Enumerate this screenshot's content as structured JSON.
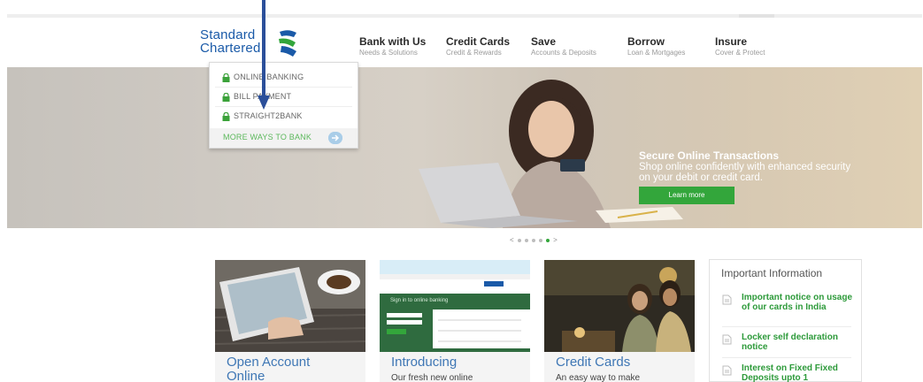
{
  "brand": {
    "name_line1": "Standard",
    "name_line2": "Chartered",
    "colors": {
      "blue": "#1a5aa8",
      "green": "#33a63b"
    }
  },
  "nav": [
    {
      "title": "Bank with Us",
      "subtitle": "Needs & Solutions"
    },
    {
      "title": "Credit Cards",
      "subtitle": "Credit & Rewards"
    },
    {
      "title": "Save",
      "subtitle": "Accounts & Deposits"
    },
    {
      "title": "Borrow",
      "subtitle": "Loan & Mortgages"
    },
    {
      "title": "Insure",
      "subtitle": "Cover & Protect"
    }
  ],
  "login_menu": {
    "items": [
      {
        "label": "ONLINE BANKING",
        "icon": "lock-icon"
      },
      {
        "label": "BILL PAYMENT",
        "icon": "lock-icon"
      },
      {
        "label": "STRAIGHT2BANK",
        "icon": "lock-icon"
      }
    ],
    "more_label": "MORE WAYS TO BANK",
    "more_icon": "arrow-right-icon"
  },
  "hero": {
    "title": "Secure Online Transactions",
    "text_line1": "Shop online confidently with enhanced security",
    "text_line2": "on your debit or credit card.",
    "button": "Learn more"
  },
  "carousel": {
    "prev": "<",
    "next": ">",
    "count": 5,
    "active": 4
  },
  "cards": [
    {
      "title": "Open Account",
      "title2": "Online",
      "desc": ""
    },
    {
      "title": "Introducing",
      "title2": "",
      "desc": "Our fresh new online",
      "screen_text": "Sign in to online banking"
    },
    {
      "title": "Credit Cards",
      "title2": "",
      "desc": "An easy way to make"
    }
  ],
  "important_info": {
    "heading": "Important Information",
    "items": [
      "Important notice on usage of our cards in India",
      "Locker self declaration notice",
      "Interest on Fixed Fixed Deposits upto 1"
    ]
  }
}
